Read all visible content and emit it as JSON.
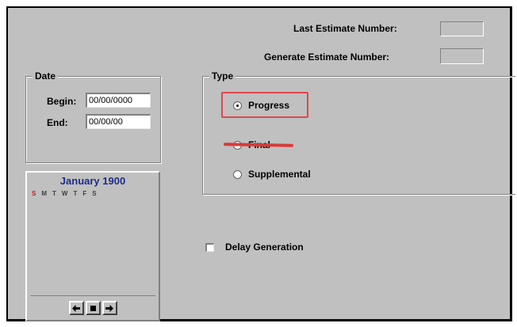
{
  "estimate": {
    "last_label": "Last Estimate Number:",
    "generate_label": "Generate Estimate Number:"
  },
  "date": {
    "group_title": "Date",
    "begin_label": "Begin:",
    "begin_value": "00/00/0000",
    "end_label": "End:",
    "end_value": "00/00/00"
  },
  "calendar": {
    "month_year": "January 1900",
    "weekdays": [
      "S",
      "M",
      "T",
      "W",
      "T",
      "F",
      "S"
    ],
    "nav": {
      "prev_icon": "arrow-left-icon",
      "stop_icon": "square-icon",
      "next_icon": "arrow-right-icon"
    }
  },
  "type": {
    "group_title": "Type",
    "options": [
      {
        "label": "Progress",
        "selected": true,
        "highlighted": true
      },
      {
        "label": "Final",
        "selected": false,
        "struck_out": true
      },
      {
        "label": "Supplemental",
        "selected": false
      }
    ]
  },
  "delay": {
    "label": "Delay Generation",
    "checked": false
  },
  "annotation_color": "#e0474c"
}
